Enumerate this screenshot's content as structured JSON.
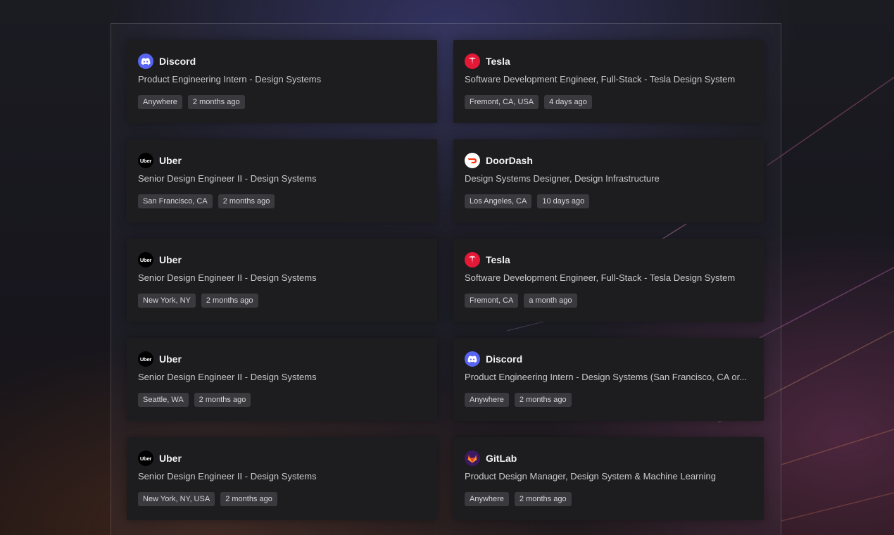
{
  "jobs": [
    {
      "company": "Discord",
      "logo": "discord-logo-icon",
      "title": "Product Engineering Intern - Design Systems",
      "location": "Anywhere",
      "posted": "2 months ago"
    },
    {
      "company": "Tesla",
      "logo": "tesla-logo-icon",
      "title": "Software Development Engineer, Full-Stack - Tesla Design System",
      "location": "Fremont, CA, USA",
      "posted": "4 days ago"
    },
    {
      "company": "Uber",
      "logo": "uber-logo-icon",
      "logo_text": "Uber",
      "title": "Senior Design Engineer II - Design Systems",
      "location": "San Francisco, CA",
      "posted": "2 months ago"
    },
    {
      "company": "DoorDash",
      "logo": "doordash-logo-icon",
      "title": "Design Systems Designer, Design Infrastructure",
      "location": "Los Angeles, CA",
      "posted": "10 days ago"
    },
    {
      "company": "Uber",
      "logo": "uber-logo-icon",
      "logo_text": "Uber",
      "title": "Senior Design Engineer II - Design Systems",
      "location": "New York, NY",
      "posted": "2 months ago"
    },
    {
      "company": "Tesla",
      "logo": "tesla-logo-icon",
      "title": "Software Development Engineer, Full-Stack - Tesla Design System",
      "location": "Fremont, CA",
      "posted": "a month ago"
    },
    {
      "company": "Uber",
      "logo": "uber-logo-icon",
      "logo_text": "Uber",
      "title": "Senior Design Engineer II - Design Systems",
      "location": "Seattle, WA",
      "posted": "2 months ago"
    },
    {
      "company": "Discord",
      "logo": "discord-logo-icon",
      "title": "Product Engineering Intern - Design Systems (San Francisco, CA or...",
      "location": "Anywhere",
      "posted": "2 months ago"
    },
    {
      "company": "Uber",
      "logo": "uber-logo-icon",
      "logo_text": "Uber",
      "title": "Senior Design Engineer II - Design Systems",
      "location": "New York, NY, USA",
      "posted": "2 months ago"
    },
    {
      "company": "GitLab",
      "logo": "gitlab-logo-icon",
      "title": "Product Design Manager, Design System & Machine Learning",
      "location": "Anywhere",
      "posted": "2 months ago"
    }
  ],
  "colors": {
    "card_bg": "#1d1d1f",
    "tag_bg": "#3a3a3e",
    "discord": "#5865f2",
    "tesla": "#e31937",
    "doordash": "#ff3008",
    "gitlab": "#fc6d26"
  }
}
